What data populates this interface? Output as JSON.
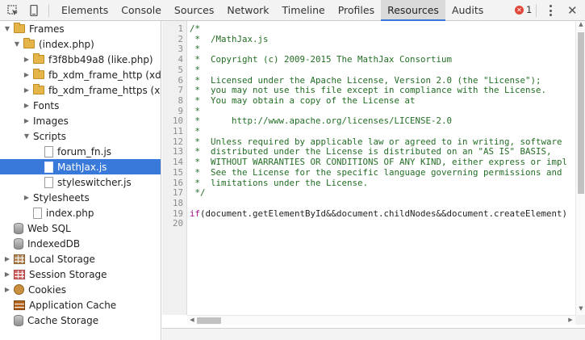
{
  "toolbar": {
    "inspect_icon": "inspect-element-icon",
    "device_icon": "device-mode-icon",
    "tabs": [
      {
        "label": "Elements"
      },
      {
        "label": "Console"
      },
      {
        "label": "Sources"
      },
      {
        "label": "Network"
      },
      {
        "label": "Timeline"
      },
      {
        "label": "Profiles"
      },
      {
        "label": "Resources"
      },
      {
        "label": "Audits"
      }
    ],
    "active_tab": "Resources",
    "error_count": "1",
    "accent_color": "#3879d9",
    "error_color": "#e0473a"
  },
  "sidebar": {
    "items": [
      {
        "label": "Frames",
        "icon": "folder-icon",
        "expand": "open"
      },
      {
        "label": "(index.php)",
        "icon": "folder-icon",
        "expand": "open"
      },
      {
        "label": "f3f8bb49a8 (like.php)",
        "icon": "folder-icon",
        "expand": "closed"
      },
      {
        "label": "fb_xdm_frame_http (xd…",
        "icon": "folder-icon",
        "expand": "closed"
      },
      {
        "label": "fb_xdm_frame_https (x…",
        "icon": "folder-icon",
        "expand": "closed"
      },
      {
        "label": "Fonts",
        "icon": "none",
        "expand": "closed"
      },
      {
        "label": "Images",
        "icon": "none",
        "expand": "closed"
      },
      {
        "label": "Scripts",
        "icon": "none",
        "expand": "open"
      },
      {
        "label": "forum_fn.js",
        "icon": "document-icon",
        "expand": "none"
      },
      {
        "label": "MathJax.js",
        "icon": "document-icon",
        "expand": "none",
        "selected": true
      },
      {
        "label": "styleswitcher.js",
        "icon": "document-icon",
        "expand": "none"
      },
      {
        "label": "Stylesheets",
        "icon": "none",
        "expand": "closed"
      },
      {
        "label": "index.php",
        "icon": "document-icon",
        "expand": "none"
      },
      {
        "label": "Web SQL",
        "icon": "database-icon",
        "expand": "none"
      },
      {
        "label": "IndexedDB",
        "icon": "database-icon",
        "expand": "none"
      },
      {
        "label": "Local Storage",
        "icon": "storage-grid-icon",
        "expand": "closed"
      },
      {
        "label": "Session Storage",
        "icon": "storage-grid-icon",
        "expand": "closed"
      },
      {
        "label": "Cookies",
        "icon": "cookie-icon",
        "expand": "closed"
      },
      {
        "label": "Application Cache",
        "icon": "app-cache-icon",
        "expand": "none"
      },
      {
        "label": "Cache Storage",
        "icon": "database-icon",
        "expand": "none"
      }
    ]
  },
  "editor": {
    "lines": [
      {
        "n": "1",
        "text": "/*",
        "type": "comment"
      },
      {
        "n": "2",
        "text": " *  /MathJax.js",
        "type": "comment"
      },
      {
        "n": "3",
        "text": " *",
        "type": "comment"
      },
      {
        "n": "4",
        "text": " *  Copyright (c) 2009-2015 The MathJax Consortium",
        "type": "comment"
      },
      {
        "n": "5",
        "text": " *",
        "type": "comment"
      },
      {
        "n": "6",
        "text": " *  Licensed under the Apache License, Version 2.0 (the \"License\");",
        "type": "comment"
      },
      {
        "n": "7",
        "text": " *  you may not use this file except in compliance with the License.",
        "type": "comment"
      },
      {
        "n": "8",
        "text": " *  You may obtain a copy of the License at",
        "type": "comment"
      },
      {
        "n": "9",
        "text": " *",
        "type": "comment"
      },
      {
        "n": "10",
        "text": " *      http://www.apache.org/licenses/LICENSE-2.0",
        "type": "comment"
      },
      {
        "n": "11",
        "text": " *",
        "type": "comment"
      },
      {
        "n": "12",
        "text": " *  Unless required by applicable law or agreed to in writing, software",
        "type": "comment"
      },
      {
        "n": "13",
        "text": " *  distributed under the License is distributed on an \"AS IS\" BASIS,",
        "type": "comment"
      },
      {
        "n": "14",
        "text": " *  WITHOUT WARRANTIES OR CONDITIONS OF ANY KIND, either express or impl",
        "type": "comment"
      },
      {
        "n": "15",
        "text": " *  See the License for the specific language governing permissions and",
        "type": "comment"
      },
      {
        "n": "16",
        "text": " *  limitations under the License.",
        "type": "comment"
      },
      {
        "n": "17",
        "text": " */",
        "type": "comment"
      },
      {
        "n": "18",
        "text": "",
        "type": "code"
      },
      {
        "n": "19",
        "keyword": "if",
        "text": "(document.getElementById&&document.childNodes&&document.createElement)",
        "type": "code"
      },
      {
        "n": "20",
        "text": "",
        "type": "code"
      }
    ]
  }
}
